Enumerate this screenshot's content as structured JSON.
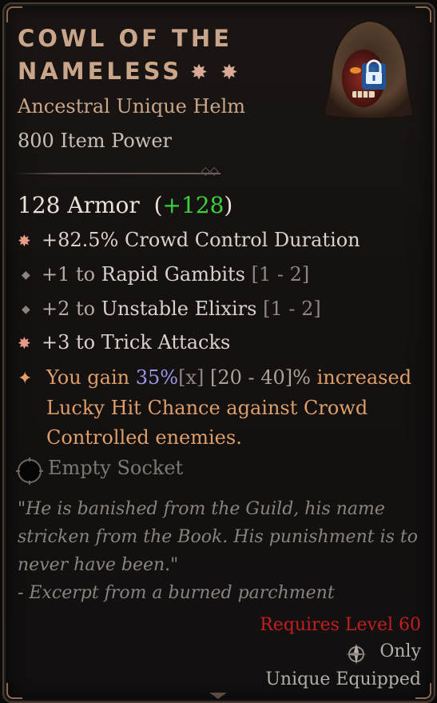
{
  "item": {
    "title": "Cowl of the Nameless",
    "subtitle": "Ancestral Unique Helm",
    "item_power": "800 Item Power",
    "armor_text": "128 Armor",
    "armor_bonus_open": "(",
    "armor_bonus": "+128",
    "armor_bonus_close": ")",
    "icon": "hooded-mask-lock-icon"
  },
  "affixes": [
    {
      "prefix": "+82.5% Crowd Control Duration",
      "suffix": "",
      "range": "",
      "bullet": "star"
    },
    {
      "prefix": "+1 to",
      "suffix": "Rapid Gambits",
      "range": "[1 - 2]",
      "bullet": "diamond"
    },
    {
      "prefix": "+2 to",
      "suffix": "Unstable Elixirs",
      "range": "[1 - 2]",
      "bullet": "diamond"
    },
    {
      "prefix": "+3 to Trick Attacks",
      "suffix": "",
      "range": "",
      "bullet": "star"
    }
  ],
  "unique_power": {
    "lead": "You gain",
    "value": "35%",
    "x": "[x]",
    "range": "[20 - 40]%",
    "rest1": "increased",
    "line2": "Lucky Hit Chance against Crowd",
    "line3": "Controlled enemies."
  },
  "socket": {
    "label": "Empty Socket"
  },
  "flavor": {
    "line1": "\"He is banished from the Guild, his name",
    "line2": "stricken from the Book. His punishment is to",
    "line3": "never have been.\"",
    "line4": "- Excerpt from a burned parchment"
  },
  "requirements": {
    "level": "Requires Level 60",
    "only": "Only",
    "equipped": "Unique Equipped"
  },
  "colors": {
    "accent_bonus": "#3bd23b",
    "unique_text": "#dd9e6a",
    "requirement": "#c21f1f",
    "value_highlight": "#9a97e6"
  }
}
